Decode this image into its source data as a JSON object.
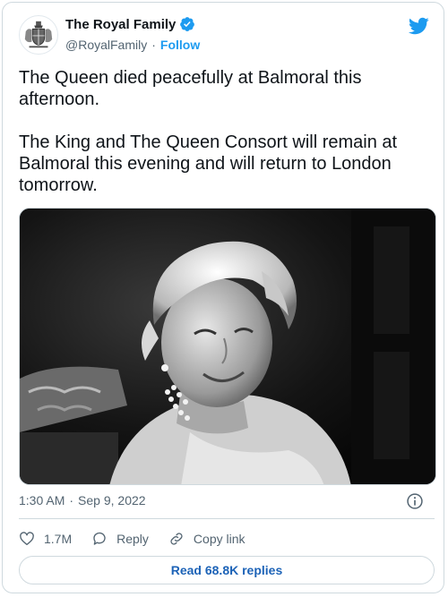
{
  "account": {
    "display_name": "The Royal Family",
    "handle": "@RoyalFamily",
    "separator": "·",
    "follow_label": "Follow",
    "verified": true
  },
  "tweet": {
    "text": "The Queen died peacefully at Balmoral this afternoon.\n\nThe King and The Queen Consort will remain at Balmoral this evening and will return to London tomorrow.",
    "time": "1:30 AM",
    "separator": "·",
    "date": "Sep 9, 2022",
    "media_alt": "Black and white portrait photograph of Queen Elizabeth II smiling"
  },
  "actions": {
    "likes_count": "1.7M",
    "reply_label": "Reply",
    "copy_link_label": "Copy link"
  },
  "replies_button": {
    "label": "Read 68.8K replies"
  },
  "icons": {
    "bird": "twitter-bird-icon",
    "verified": "verified-badge-icon",
    "info": "info-icon",
    "heart": "heart-icon",
    "reply": "reply-icon",
    "link": "link-icon"
  },
  "colors": {
    "accent": "#1d9bf0",
    "text": "#0f1419",
    "secondary_text": "#536471",
    "border": "#cfd9de",
    "link_text": "#1d63b7"
  }
}
